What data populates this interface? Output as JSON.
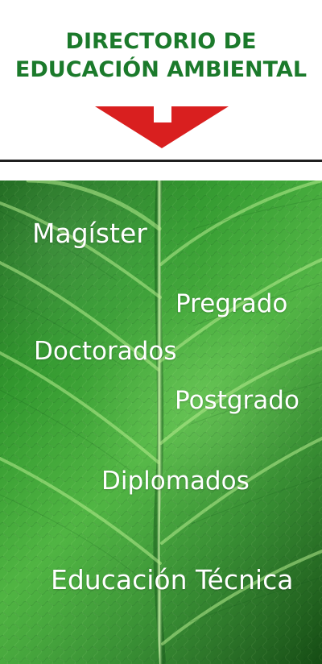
{
  "header": {
    "title_line_1": "DIRECTORIO DE",
    "title_line_2": "EDUCACIÓN AMBIENTAL"
  },
  "colors": {
    "title": "#1b7a2b",
    "arrow": "#d91f1f",
    "leaf_green": "#2f9b2b",
    "menu_text": "#ffffff"
  },
  "menu": {
    "items": [
      {
        "label": "Magíster"
      },
      {
        "label": "Pregrado"
      },
      {
        "label": "Doctorados"
      },
      {
        "label": "Postgrado"
      },
      {
        "label": "Diplomados"
      },
      {
        "label": "Educación Técnica"
      }
    ]
  },
  "icons": {
    "arrow": "down-arrow-icon",
    "background": "green-leaf-image"
  }
}
